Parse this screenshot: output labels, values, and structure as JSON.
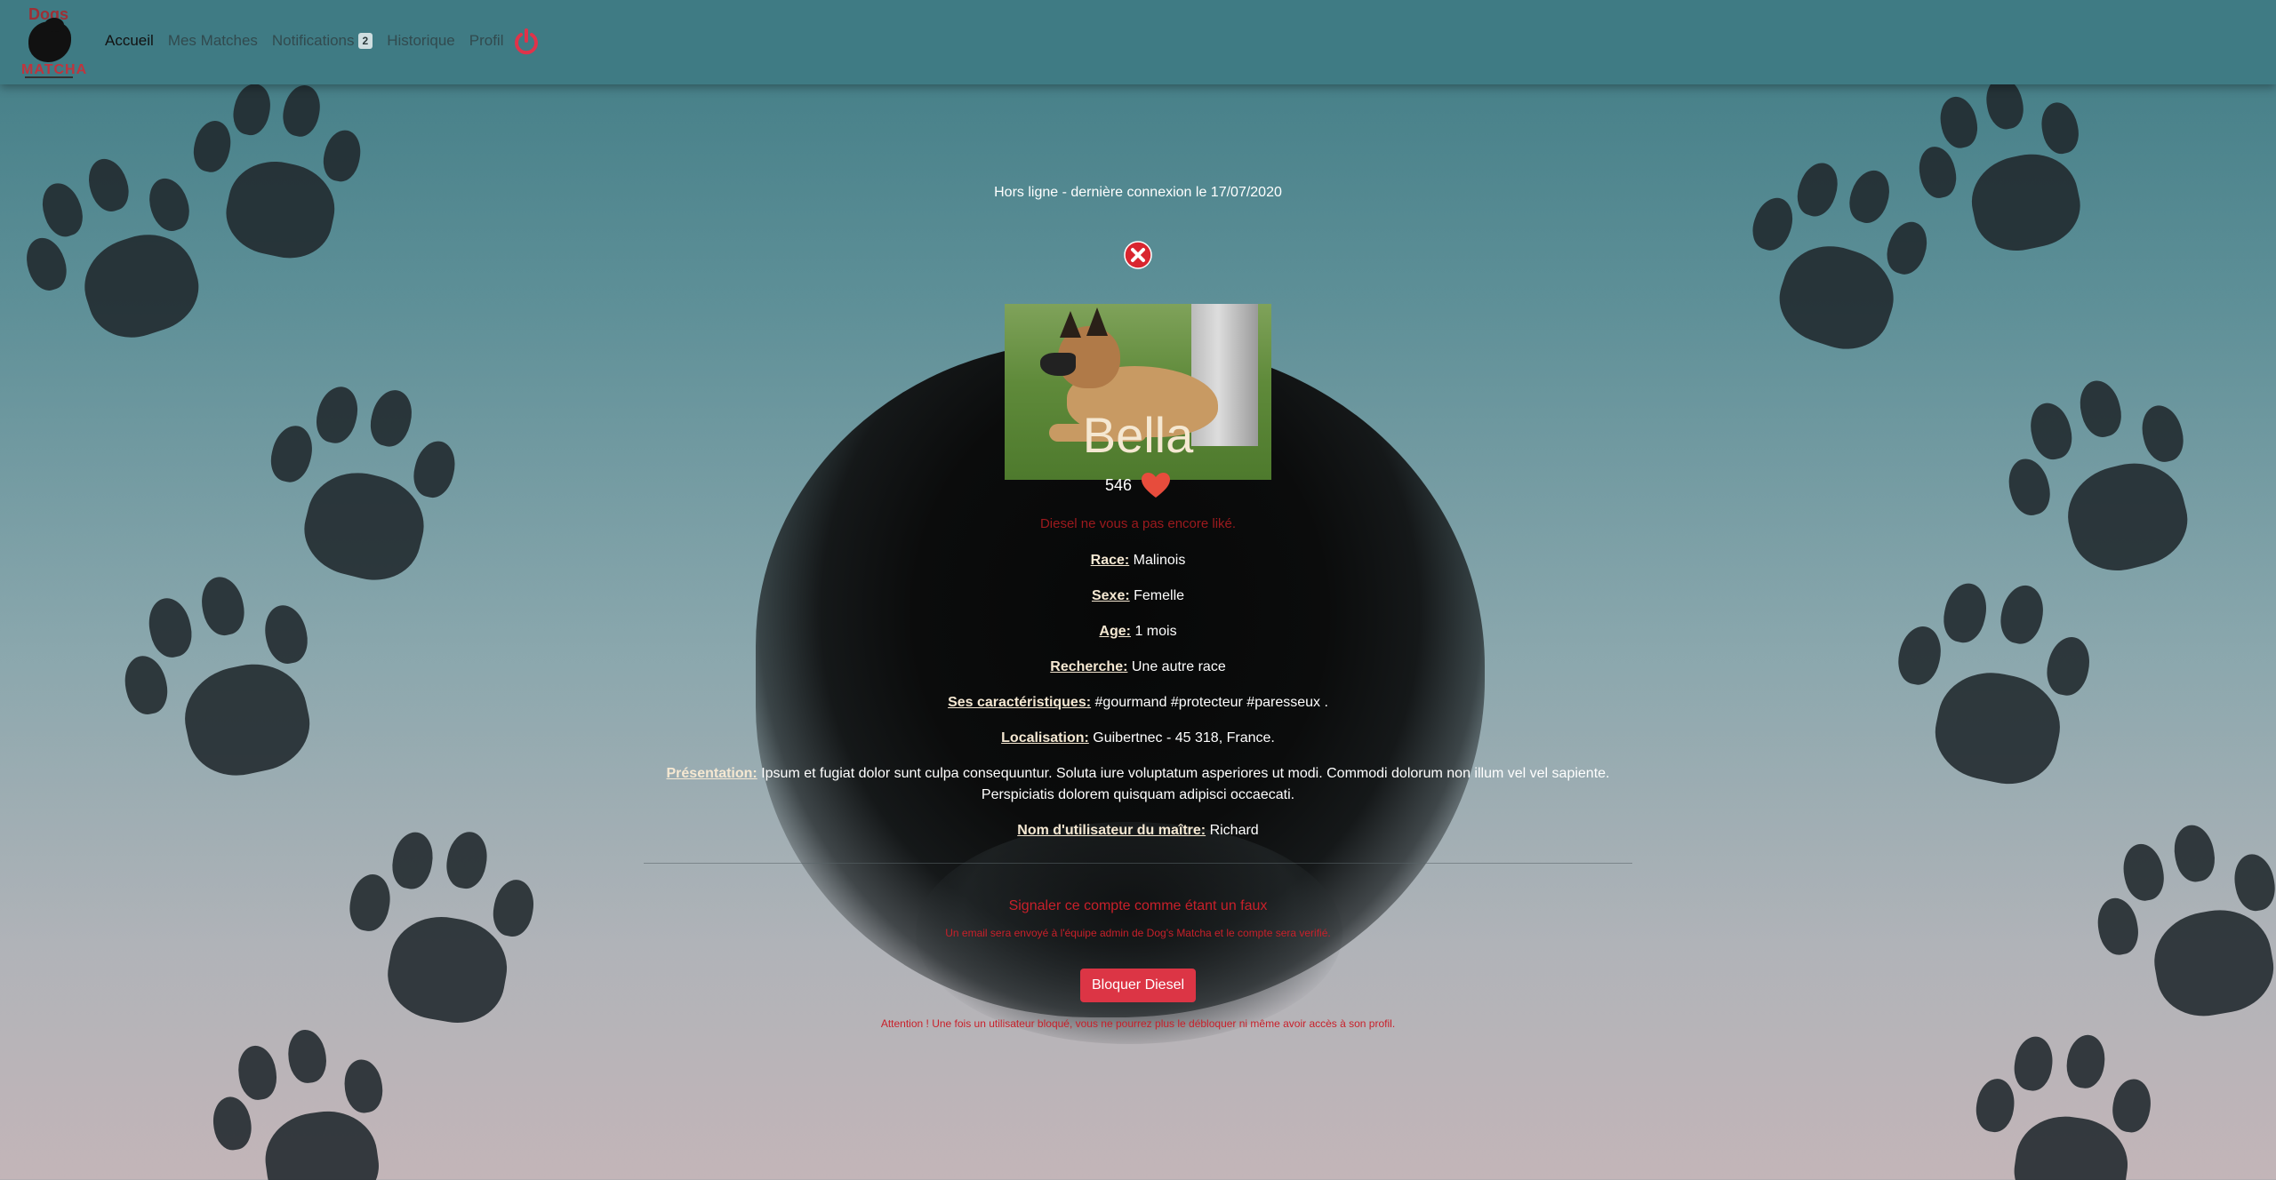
{
  "nav": {
    "logo_top": "Dogs",
    "logo_name": "MATCHA",
    "links": [
      {
        "label": "Accueil"
      },
      {
        "label": "Mes Matches"
      },
      {
        "label": "Notifications"
      },
      {
        "label": "Historique"
      },
      {
        "label": "Profil"
      }
    ],
    "notification_count": "2",
    "logout_icon": "power-icon"
  },
  "profile": {
    "status_icon": "offline-x-icon",
    "status_text": "Hors ligne - dernière connexion le 17/07/2020",
    "photo_icon": "dog-photo",
    "name": "Bella",
    "likes": "546",
    "likes_icon": "heart-icon",
    "not_liked_text": "Diesel ne vous a pas encore liké.",
    "fields": {
      "race": {
        "label": "Race:",
        "value": "Malinois"
      },
      "sexe": {
        "label": "Sexe:",
        "value": "Femelle"
      },
      "age": {
        "label": "Age:",
        "value": "1 mois"
      },
      "recherche": {
        "label": "Recherche:",
        "value": "Une autre race"
      },
      "caracteristiques": {
        "label": "Ses caractéristiques:",
        "value": "#gourmand #protecteur #paresseux ."
      },
      "localisation": {
        "label": "Localisation:",
        "value": "Guibertnec - 45 318, France."
      },
      "presentation": {
        "label": "Présentation:",
        "value_line1": "Ipsum et fugiat dolor sunt culpa consequuntur. Soluta iure voluptatum asperiores ut modi. Commodi dolorum non illum vel vel sapiente.",
        "value_line2": "Perspiciatis dolorem quisquam adipisci occaecati."
      },
      "maitre": {
        "label": "Nom d'utilisateur du maître:",
        "value": "Richard"
      }
    }
  },
  "actions": {
    "report_link": "Signaler ce compte comme étant un faux",
    "report_note": "Un email sera envoyé à l'équipe admin de Dog's Matcha et le compte sera verifié.",
    "block_button": "Bloquer Diesel",
    "block_warning": "Attention ! Une fois un utilisateur bloqué, vous ne pourrez plus le débloquer ni même avoir accès à son profil."
  },
  "colors": {
    "accent_red": "#dc3545",
    "nav_bg": "#3f7b84",
    "heart": "#e74c3c",
    "name_color": "#f5e8d2"
  }
}
